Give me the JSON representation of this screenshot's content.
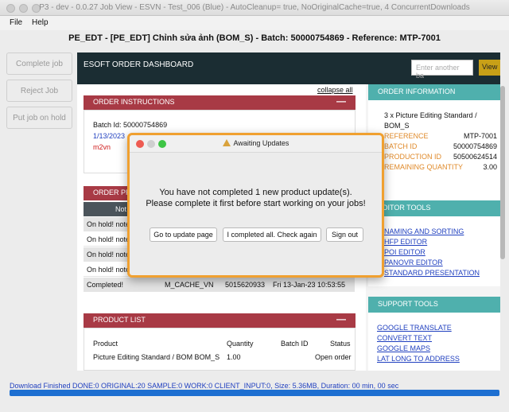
{
  "window": {
    "title": "P3 - dev - 0.0.27 Job View  - ESVN - Test_006 (Blue) - AutoCleanup= true, NoOriginalCache=true, 4 ConcurrentDownloads"
  },
  "menu": {
    "file": "File",
    "help": "Help"
  },
  "header": {
    "line": "PE_EDT - [PE_EDT] Chỉnh sửa ảnh (BOM_S) - Batch: 50000754869 - Reference: MTP-7001"
  },
  "sidebar": {
    "complete": "Complete job",
    "reject": "Reject Job",
    "hold": "Put job on hold"
  },
  "dashboard": {
    "title": "ESOFT ORDER DASHBOARD",
    "search_placeholder": "Enter another ba",
    "view": "View",
    "collapse_all": "collapse all"
  },
  "order_instructions": {
    "title": "ORDER INSTRUCTIONS",
    "batch_id": "Batch Id: 50000754869",
    "date": "1/13/2023",
    "user": "m2vn"
  },
  "order_progress": {
    "title": "ORDER PR",
    "col_note": "Not",
    "rows": [
      {
        "text": "On hold! note"
      },
      {
        "text": "On hold! note"
      },
      {
        "text": "On hold! note"
      },
      {
        "text": "On hold! note"
      }
    ],
    "completed": {
      "status": "Completed!",
      "step": "M_CACHE_VN",
      "id": "5015620933",
      "time": "Fri 13-Jan-23 10:53:55"
    }
  },
  "product_list": {
    "title": "PRODUCT LIST",
    "col_product": "Product",
    "col_quantity": "Quantity",
    "col_batch": "Batch ID",
    "col_status": "Status",
    "row_product": "Picture Editing Standard / BOM BOM_S",
    "row_quantity": "1.00",
    "row_status": "Open order"
  },
  "order_information": {
    "title": "ORDER INFORMATION",
    "desc_line1": "3 x Picture Editing Standard /",
    "desc_line2": "BOM_S",
    "reference_label": "REFERENCE",
    "reference_value": "MTP-7001",
    "batch_label": "BATCH ID",
    "batch_value": "50000754869",
    "production_label": "PRODUCTION ID",
    "production_value": "50500624514",
    "remaining_label": "REMAINING QUANTITY",
    "remaining_value": "3.00"
  },
  "editor_tools": {
    "title": "EDITOR TOOLS",
    "items": [
      "NAMING AND SORTING",
      "HFP EDITOR",
      "POI EDITOR",
      "PANOVR EDITOR",
      "STANDARD PRESENTATION"
    ]
  },
  "support_tools": {
    "title": "SUPPORT TOOLS",
    "items": [
      "GOOGLE TRANSLATE",
      "CONVERT TEXT",
      "GOOGLE MAPS",
      "LAT LONG TO ADDRESS"
    ]
  },
  "dialog": {
    "title": "Awaiting Updates",
    "message_line1": "You have not completed 1 new product update(s).",
    "message_line2": "Please complete it first before start working on your jobs!",
    "btn_update": "Go to update page",
    "btn_completed": "I completed all. Check again",
    "btn_signout": "Sign out"
  },
  "status": {
    "text": "Download Finished DONE:0 ORIGINAL:20 SAMPLE:0 WORK:0 CLIENT_INPUT:0, Size: 5.36MB, Duration: 00 min, 00 sec",
    "progress": 1.0
  },
  "colors": {
    "red_header": "#a83a45",
    "teal_header": "#4fb0ad",
    "dark_header": "#1b2d33",
    "dialog_border": "#f0a030"
  }
}
